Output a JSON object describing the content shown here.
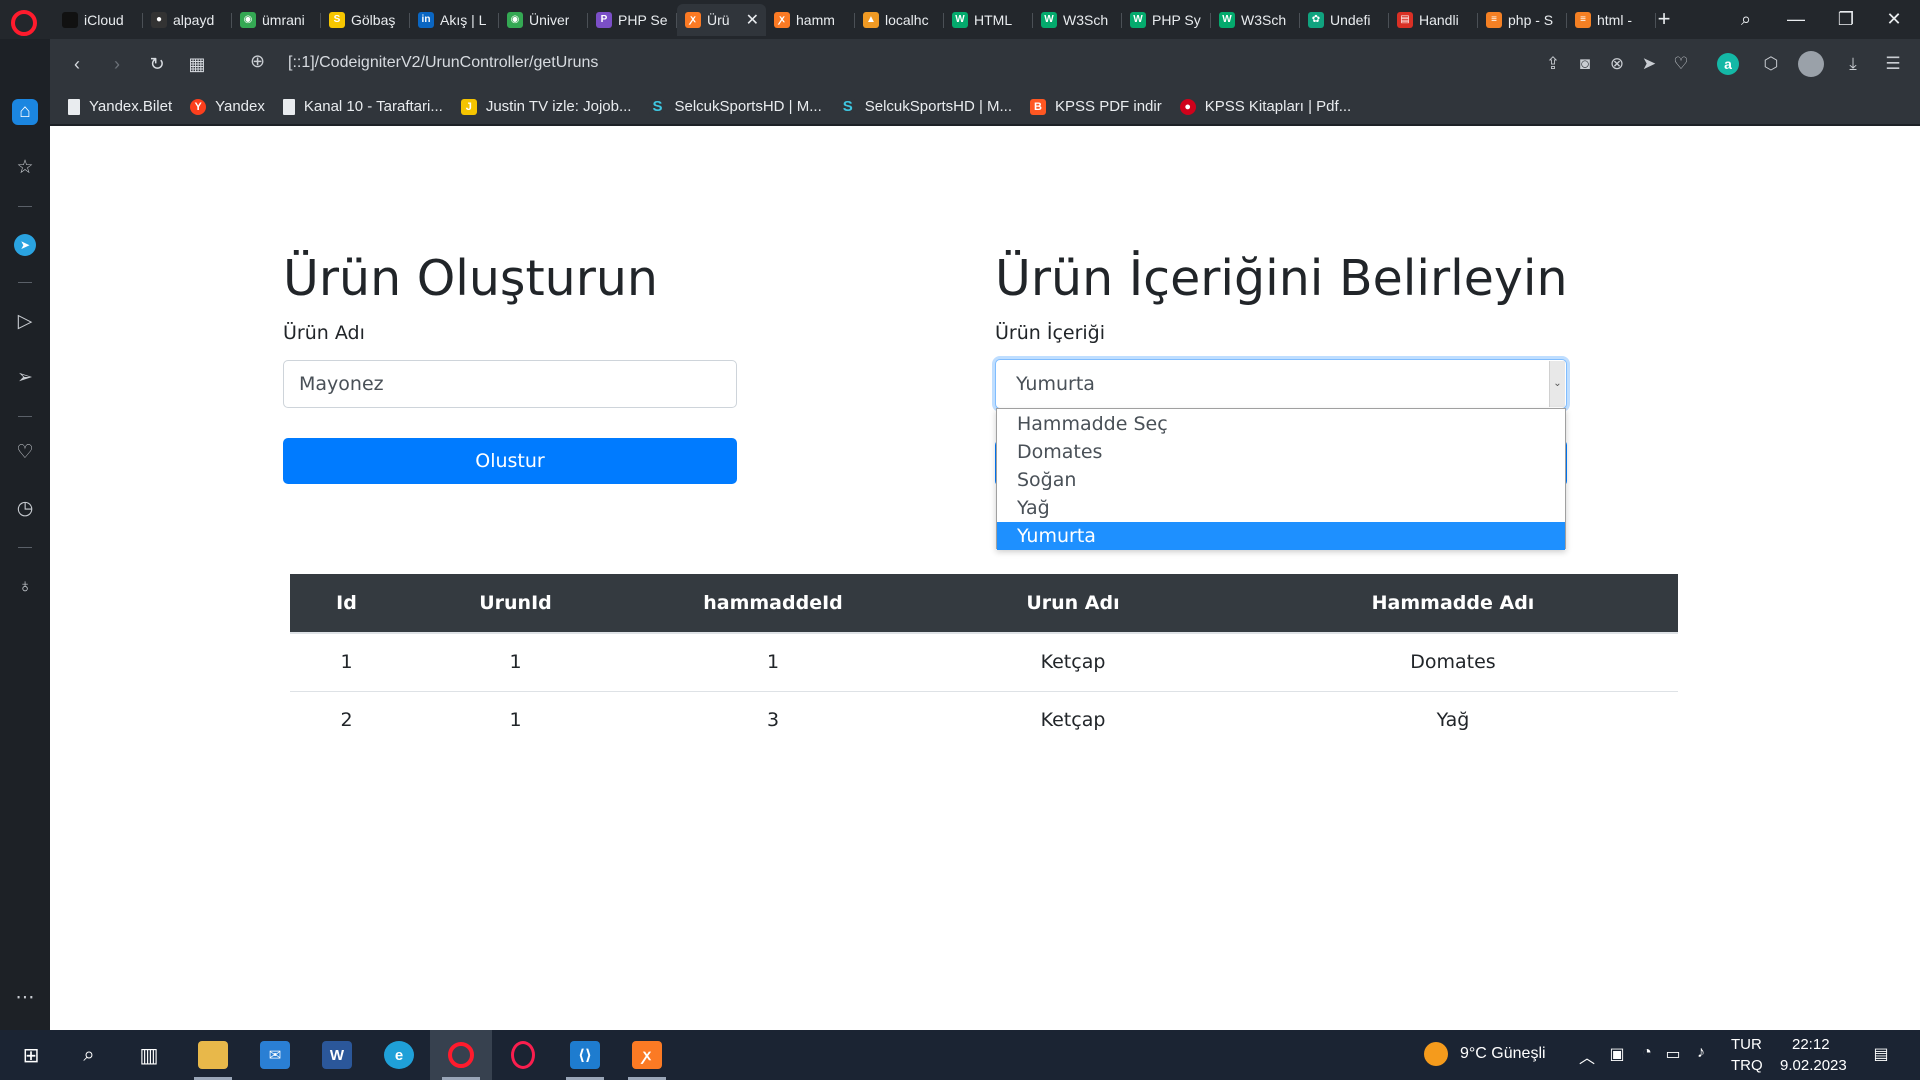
{
  "colors": {
    "opera_red": "#ff1b2d",
    "primary_button": "#007bff",
    "dropdown_highlight": "#1e90ff",
    "table_header": "#343a40",
    "taskbar": "#1b2433"
  },
  "tabs": [
    {
      "label": "iCloud",
      "icon": "apple-icon"
    },
    {
      "label": "alpayd",
      "icon": "github-icon"
    },
    {
      "label": "ümrani",
      "icon": "map-pin-icon"
    },
    {
      "label": "Gölbaş",
      "icon": "s-logo-icon"
    },
    {
      "label": "Akış | L",
      "icon": "linkedin-icon"
    },
    {
      "label": "Üniver",
      "icon": "map-pin-icon"
    },
    {
      "label": "PHP Se",
      "icon": "p-logo-icon"
    },
    {
      "label": "Ürü",
      "icon": "xampp-icon",
      "active": true
    },
    {
      "label": "hamm",
      "icon": "xampp-icon"
    },
    {
      "label": "localhc",
      "icon": "phpmyadmin-icon"
    },
    {
      "label": "HTML",
      "icon": "w3schools-icon"
    },
    {
      "label": "W3Sch",
      "icon": "w3schools-icon"
    },
    {
      "label": "PHP Sy",
      "icon": "w3schools-icon"
    },
    {
      "label": "W3Sch",
      "icon": "w3schools-icon"
    },
    {
      "label": "Undefi",
      "icon": "chatgpt-icon"
    },
    {
      "label": "Handli",
      "icon": "doc-icon"
    },
    {
      "label": "php - S",
      "icon": "stackoverflow-icon"
    },
    {
      "label": "html -",
      "icon": "stackoverflow-icon"
    }
  ],
  "address_bar": {
    "url": "[::1]/CodeigniterV2/UrunController/getUruns"
  },
  "bookmarks": [
    {
      "label": "Yandex.Bilet",
      "icon": "page-icon"
    },
    {
      "label": "Yandex",
      "icon": "yandex-icon"
    },
    {
      "label": "Kanal 10 - Taraftari...",
      "icon": "page-icon"
    },
    {
      "label": "Justin TV izle: Jojob...",
      "icon": "j-logo-icon"
    },
    {
      "label": "SelcukSportsHD | M...",
      "icon": "s-swirl-icon"
    },
    {
      "label": "SelcukSportsHD | M...",
      "icon": "s-swirl-icon"
    },
    {
      "label": "KPSS PDF indir",
      "icon": "blogger-icon"
    },
    {
      "label": "KPSS Kitapları | Pdf...",
      "icon": "red-circle-icon"
    }
  ],
  "page": {
    "left": {
      "title": "Ürün Oluşturun",
      "label": "Ürün Adı",
      "input_value": "Mayonez",
      "button_label": "Olustur"
    },
    "right": {
      "title": "Ürün İçeriğini Belirleyin",
      "label": "Ürün İçeriği",
      "selected_value": "Yumurta",
      "options": [
        "Hammadde Seç",
        "Domates",
        "Soğan",
        "Yağ",
        "Yumurta"
      ]
    },
    "table": {
      "headers": [
        "Id",
        "UrunId",
        "hammaddeId",
        "Urun Adı",
        "Hammadde Adı"
      ],
      "rows": [
        [
          "1",
          "1",
          "1",
          "Ketçap",
          "Domates"
        ],
        [
          "2",
          "1",
          "3",
          "Ketçap",
          "Yağ"
        ]
      ]
    }
  },
  "taskbar": {
    "weather": "9°C Güneşli",
    "lang_top": "TUR",
    "lang_bottom": "TRQ",
    "time": "22:12",
    "date": "9.02.2023"
  }
}
